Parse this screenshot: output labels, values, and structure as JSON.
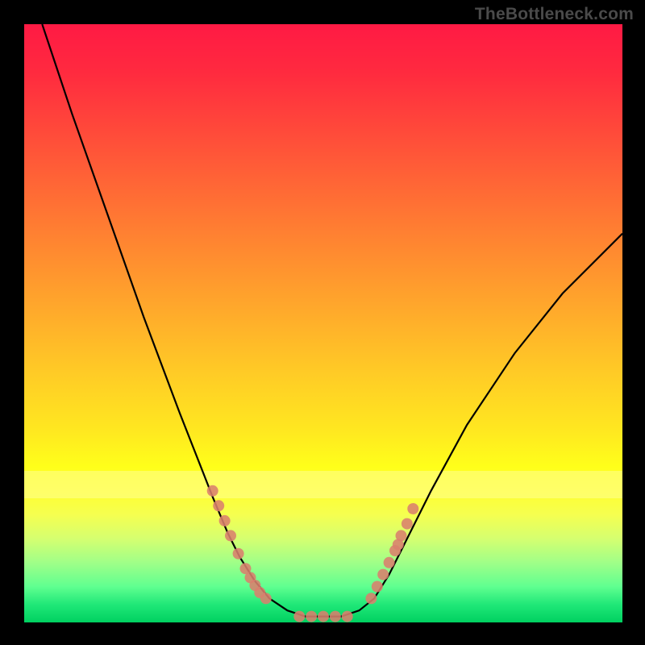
{
  "attribution": "TheBottleneck.com",
  "chart_data": {
    "type": "line",
    "title": "",
    "xlabel": "",
    "ylabel": "",
    "xlim": [
      0,
      100
    ],
    "ylim": [
      0,
      100
    ],
    "series": [
      {
        "name": "bottleneck-curve",
        "x": [
          3,
          8,
          14,
          20,
          26,
          31.5,
          34,
          36,
          38.5,
          41,
          44,
          47,
          50,
          53,
          56,
          58.5,
          61,
          64,
          68,
          74,
          82,
          90,
          100
        ],
        "y": [
          100,
          85,
          68,
          51,
          35,
          21,
          15,
          11,
          7,
          4,
          2,
          1,
          1,
          1,
          2,
          4,
          8,
          14,
          22,
          33,
          45,
          55,
          65
        ]
      },
      {
        "name": "left-cluster",
        "type": "scatter",
        "x": [
          31.5,
          32.5,
          33.5,
          34.5,
          35.8,
          37.0,
          37.8,
          38.6,
          39.4,
          40.4
        ],
        "y": [
          22,
          19.5,
          17,
          14.5,
          11.5,
          9,
          7.5,
          6.2,
          5,
          4
        ]
      },
      {
        "name": "bottom-cluster",
        "type": "scatter",
        "x": [
          46,
          48,
          50,
          52,
          54
        ],
        "y": [
          1,
          1,
          1,
          1,
          1
        ]
      },
      {
        "name": "right-cluster",
        "type": "scatter",
        "x": [
          58,
          59,
          60,
          61,
          62,
          62.5,
          63,
          64,
          65
        ],
        "y": [
          4,
          6,
          8,
          10,
          12,
          13,
          14.5,
          16.5,
          19
        ]
      }
    ],
    "bands": [
      {
        "name": "highlight-band",
        "y0": 20,
        "y1": 25
      }
    ],
    "background_gradient": [
      "#ff1a44",
      "#ffaa2b",
      "#ffff1a",
      "#00d060"
    ]
  }
}
